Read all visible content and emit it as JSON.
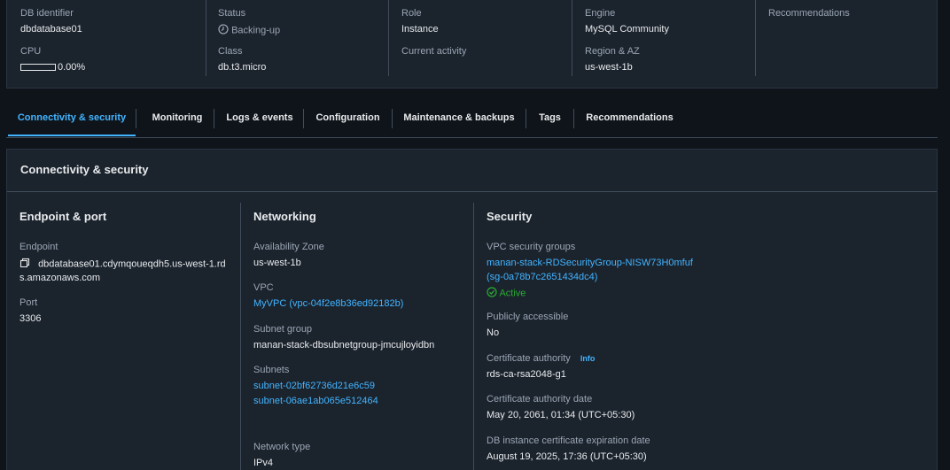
{
  "summary": {
    "db_identifier_label": "DB identifier",
    "db_identifier_value": "dbdatabase01",
    "cpu_label": "CPU",
    "cpu_value": "0.00%",
    "cpu_percent": 0,
    "status_label": "Status",
    "status_value": "Backing-up",
    "class_label": "Class",
    "class_value": "db.t3.micro",
    "role_label": "Role",
    "role_value": "Instance",
    "current_activity_label": "Current activity",
    "engine_label": "Engine",
    "engine_value": "MySQL Community",
    "region_label": "Region & AZ",
    "region_value": "us-west-1b",
    "recommendations_label": "Recommendations"
  },
  "tabs": [
    {
      "label": "Connectivity & security",
      "active": true
    },
    {
      "label": "Monitoring",
      "active": false
    },
    {
      "label": "Logs & events",
      "active": false
    },
    {
      "label": "Configuration",
      "active": false
    },
    {
      "label": "Maintenance & backups",
      "active": false
    },
    {
      "label": "Tags",
      "active": false
    },
    {
      "label": "Recommendations",
      "active": false
    }
  ],
  "panel": {
    "title": "Connectivity & security",
    "endpoint": {
      "title": "Endpoint & port",
      "endpoint_label": "Endpoint",
      "endpoint_line1": "dbdatabase01.cdymqoueqdh5.us-west-1.rd",
      "endpoint_line2": "s.amazonaws.com",
      "port_label": "Port",
      "port_value": "3306"
    },
    "networking": {
      "title": "Networking",
      "az_label": "Availability Zone",
      "az_value": "us-west-1b",
      "vpc_label": "VPC",
      "vpc_value": "MyVPC (vpc-04f2e8b36ed92182b)",
      "subnet_group_label": "Subnet group",
      "subnet_group_value": "manan-stack-dbsubnetgroup-jmcujloyidbn",
      "subnets_label": "Subnets",
      "subnet_1": "subnet-02bf62736d21e6c59",
      "subnet_2": "subnet-06ae1ab065e512464",
      "network_type_label": "Network type",
      "network_type_value": "IPv4"
    },
    "security": {
      "title": "Security",
      "vpc_sg_label": "VPC security groups",
      "vpc_sg_line1": "manan-stack-RDSecurityGroup-NISW73H0mfuf",
      "vpc_sg_line2": "(sg-0a78b7c2651434dc4)",
      "sg_status": "Active",
      "public_label": "Publicly accessible",
      "public_value": "No",
      "ca_label": "Certificate authority",
      "ca_info": "Info",
      "ca_value": "rds-ca-rsa2048-g1",
      "ca_date_label": "Certificate authority date",
      "ca_date_value": "May 20, 2061, 01:34 (UTC+05:30)",
      "cert_exp_label": "DB instance certificate expiration date",
      "cert_exp_value": "August 19, 2025, 17:36 (UTC+05:30)"
    }
  },
  "colors": {
    "background": "#0f141a",
    "card": "#1b232d",
    "accent": "#42b4ff",
    "success": "#29ad32",
    "text": "#e9ebed",
    "muted": "#9ba7b6"
  },
  "icons": {
    "status": "clock-icon",
    "copy": "copy-icon",
    "active": "check-circle-icon"
  }
}
